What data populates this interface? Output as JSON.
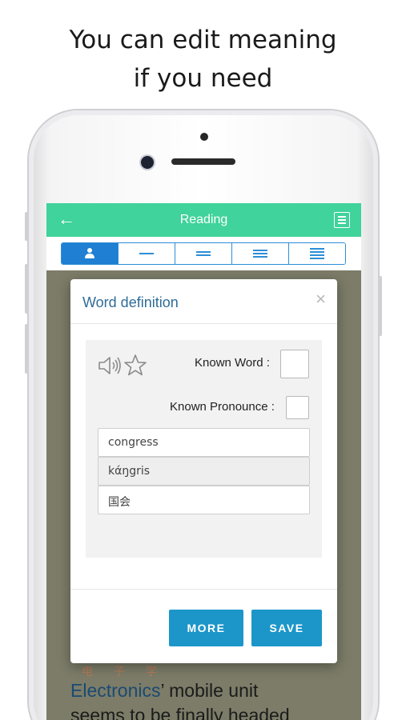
{
  "headline": {
    "line1": "You can edit meaning",
    "line2": "if you need"
  },
  "appbar": {
    "back_icon": "arrow-left-icon",
    "title": "Reading",
    "menu_icon": "list-icon"
  },
  "segments": [
    {
      "icon": "person-icon",
      "selected": true
    },
    {
      "icon": "one-line-icon",
      "selected": false
    },
    {
      "icon": "two-lines-icon",
      "selected": false
    },
    {
      "icon": "three-lines-icon",
      "selected": false
    },
    {
      "icon": "four-lines-icon",
      "selected": false
    }
  ],
  "article": {
    "ruby": "电子学",
    "link_text": "Electronics",
    "line1_rest": "’ mobile unit",
    "line2": "seems to be finally headed"
  },
  "dialog": {
    "title": "Word definition",
    "close_glyph": "×",
    "known_word_label": "Known Word :",
    "known_pronounce_label": "Known Pronounce :",
    "known_word_checked": false,
    "known_pronounce_checked": false,
    "word": "congress",
    "pronunciation": "kάŋgris",
    "meaning": "国会",
    "more_label": "MORE",
    "save_label": "SAVE"
  },
  "colors": {
    "appbar": "#40d39b",
    "segment_accent": "#1e7fd3",
    "dialog_title": "#2f6c97",
    "button": "#1c96c9",
    "overlay": "#7c7c68"
  }
}
